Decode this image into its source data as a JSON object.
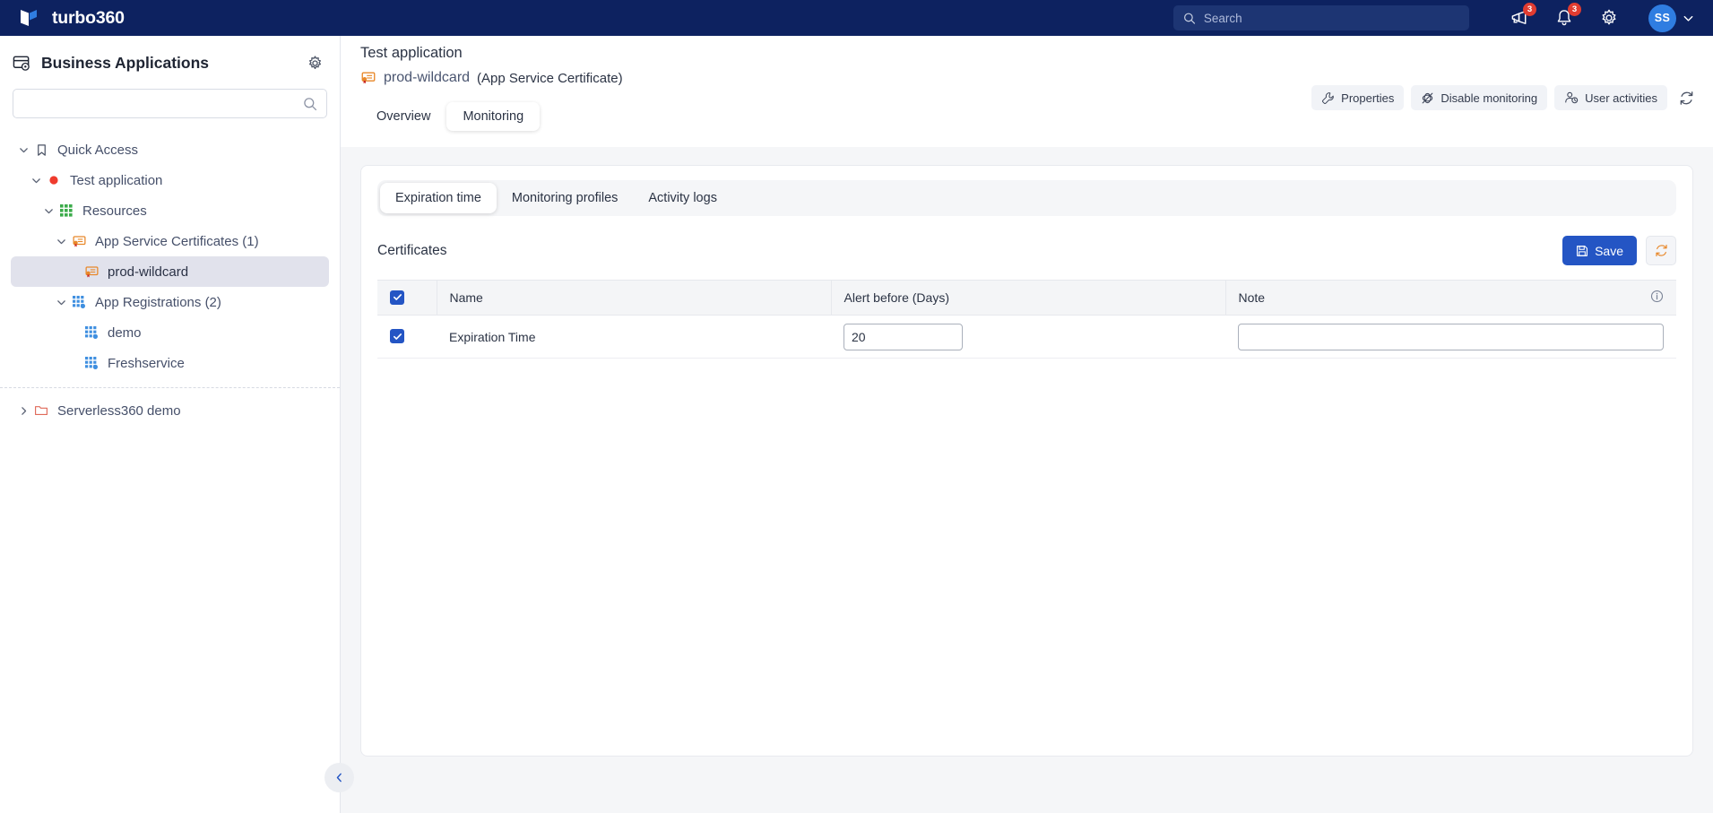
{
  "topbar": {
    "brand_name": "turbo360",
    "search_placeholder": "Search",
    "search_value": "",
    "announcements_badge": "3",
    "notifications_badge": "3",
    "avatar_initials": "SS"
  },
  "sidebar": {
    "title": "Business Applications",
    "search_value": "",
    "search_placeholder": "",
    "tree": [
      {
        "label": "Quick Access",
        "icon": "bookmark-icon",
        "depth": 0,
        "expanded": true,
        "selected": false
      },
      {
        "label": "Test application",
        "icon": "red-dot-icon",
        "depth": 1,
        "expanded": true,
        "selected": false
      },
      {
        "label": "Resources",
        "icon": "grid-green-icon",
        "depth": 2,
        "expanded": true,
        "selected": false
      },
      {
        "label": "App Service Certificates (1)",
        "icon": "certificate-icon",
        "depth": 3,
        "expanded": true,
        "selected": false
      },
      {
        "label": "prod-wildcard",
        "icon": "certificate-icon",
        "depth": 4,
        "expanded": null,
        "selected": true
      },
      {
        "label": "App Registrations (2)",
        "icon": "app-registration-icon",
        "depth": 3,
        "expanded": true,
        "selected": false
      },
      {
        "label": "demo",
        "icon": "app-registration-icon",
        "depth": 4,
        "expanded": null,
        "selected": false
      },
      {
        "label": "Freshservice",
        "icon": "app-registration-icon",
        "depth": 4,
        "expanded": null,
        "selected": false
      }
    ],
    "tree_after_divider": [
      {
        "label": "Serverless360 demo",
        "icon": "folder-icon",
        "depth": 0,
        "expanded": false,
        "selected": false
      }
    ]
  },
  "main": {
    "page_title": "Test application",
    "resource_name": "prod-wildcard",
    "resource_type": "(App Service Certificate)",
    "actions": [
      {
        "label": "Properties",
        "icon": "wrench-icon"
      },
      {
        "label": "Disable monitoring",
        "icon": "monitor-off-icon"
      },
      {
        "label": "User activities",
        "icon": "user-clock-icon"
      }
    ],
    "refresh_icon": "refresh-icon",
    "tabs": [
      {
        "label": "Overview",
        "active": false
      },
      {
        "label": "Monitoring",
        "active": true
      }
    ],
    "subtabs": [
      {
        "label": "Expiration time",
        "active": true
      },
      {
        "label": "Monitoring profiles",
        "active": false
      },
      {
        "label": "Activity logs",
        "active": false
      }
    ],
    "section_title": "Certificates",
    "save_label": "Save",
    "table": {
      "columns": [
        "",
        "Name",
        "Alert before (Days)",
        "Note"
      ],
      "header_checkbox_checked": true,
      "rows": [
        {
          "checked": true,
          "name": "Expiration Time",
          "alert_before_days": "20",
          "note": "",
          "note_placeholder": ""
        }
      ]
    }
  },
  "colors": {
    "brand_navy": "#0d2260",
    "accent_blue": "#2455c4",
    "badge_red": "#e03c31",
    "avatar_blue": "#2f7de1",
    "status_red_dot": "#ef3b2d",
    "resource_green": "#3bab4a",
    "certificate_orange": "#e8882a",
    "app_reg_blue": "#3f8fe0",
    "folder_red": "#e06a5a"
  }
}
